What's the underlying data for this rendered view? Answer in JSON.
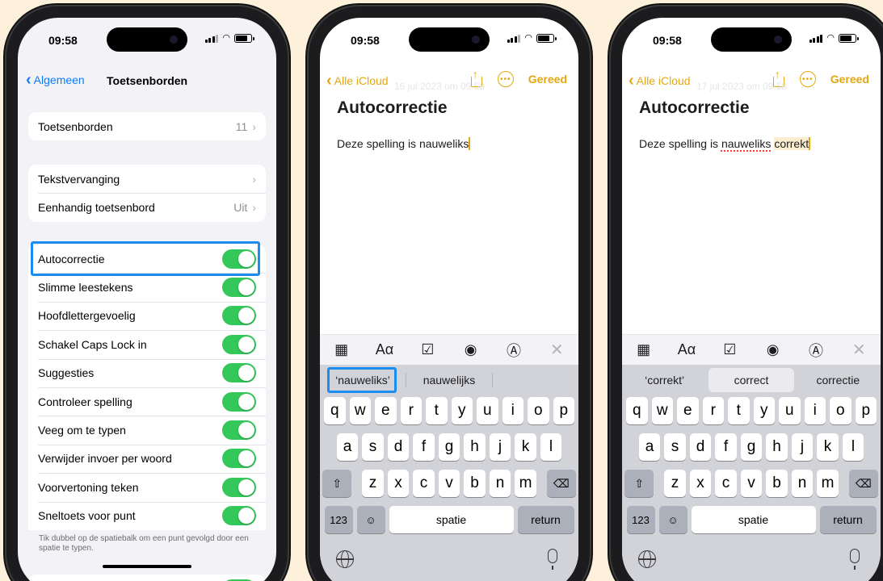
{
  "status": {
    "time": "09:58"
  },
  "settings": {
    "back_label": "Algemeen",
    "title": "Toetsenborden",
    "group1": [
      {
        "label": "Toetsenborden",
        "value": "11"
      }
    ],
    "group2": [
      {
        "label": "Tekstvervanging",
        "value": ""
      },
      {
        "label": "Eenhandig toetsenbord",
        "value": "Uit"
      }
    ],
    "toggles": [
      {
        "label": "Autocorrectie",
        "on": true
      },
      {
        "label": "Slimme leestekens",
        "on": true
      },
      {
        "label": "Hoofdlettergevoelig",
        "on": true
      },
      {
        "label": "Schakel Caps Lock in",
        "on": true
      },
      {
        "label": "Suggesties",
        "on": true
      },
      {
        "label": "Controleer spelling",
        "on": true
      },
      {
        "label": "Veeg om te typen",
        "on": true
      },
      {
        "label": "Verwijder invoer per woord",
        "on": true
      },
      {
        "label": "Voorvertoning teken",
        "on": true
      },
      {
        "label": "Sneltoets voor punt",
        "on": true
      }
    ],
    "footnote": "Tik dubbel op de spatiebalk om een punt gevolgd door een spatie te typen."
  },
  "notes1": {
    "back_label": "Alle iCloud",
    "done_label": "Gereed",
    "ghost_date": "16 jul 2023 om 09:58",
    "title": "Autocorrectie",
    "body": "Deze spelling is nauweliks",
    "suggestions": [
      "‘nauweliks’",
      "nauwelijks",
      ""
    ]
  },
  "notes2": {
    "back_label": "Alle iCloud",
    "done_label": "Gereed",
    "ghost_date": "17 jul 2023 om 09:58",
    "title": "Autocorrectie",
    "body_prefix": "Deze spelling is ",
    "body_misspelled": "nauweliks",
    "body_highlight": "correkt",
    "suggestions": [
      "‘correkt’",
      "correct",
      "correctie"
    ]
  },
  "keyboard": {
    "row1": [
      "q",
      "w",
      "e",
      "r",
      "t",
      "y",
      "u",
      "i",
      "o",
      "p"
    ],
    "row2": [
      "a",
      "s",
      "d",
      "f",
      "g",
      "h",
      "j",
      "k",
      "l"
    ],
    "row3": [
      "z",
      "x",
      "c",
      "v",
      "b",
      "n",
      "m"
    ],
    "shift": "⇧",
    "backspace": "⌫",
    "num": "123",
    "emoji": "☺",
    "space": "spatie",
    "return": "return"
  },
  "toolbar_icons": [
    "table-icon",
    "text-format-icon",
    "checklist-icon",
    "camera-icon",
    "markup-icon",
    "close-icon"
  ],
  "toolbar_glyphs": {
    "table": "▦",
    "format": "Aα",
    "checklist": "☑",
    "camera": "◉",
    "markup": "Ⓐ",
    "close": "✕"
  },
  "colors": {
    "accent_blue": "#0a7cff",
    "notes_yellow": "#e3a70f",
    "toggle_green": "#34c759",
    "highlight_blue": "#1b8cf0"
  }
}
